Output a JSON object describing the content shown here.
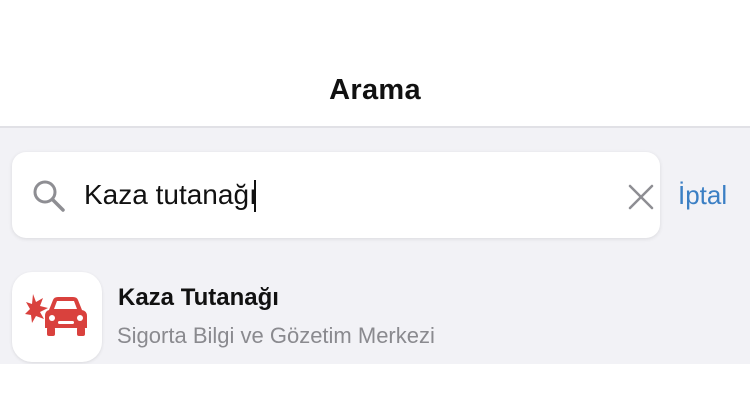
{
  "header": {
    "title": "Arama"
  },
  "search": {
    "value": "Kaza tutanağı",
    "cancel_label": "İptal"
  },
  "results": [
    {
      "title": "Kaza Tutanağı",
      "subtitle": "Sigorta Bilgi ve Gözetim Merkezi",
      "icon": "car-crash-icon"
    }
  ],
  "colors": {
    "accent": "#3b7fc4",
    "icon_red": "#d9413d",
    "background": "#f2f2f6"
  }
}
